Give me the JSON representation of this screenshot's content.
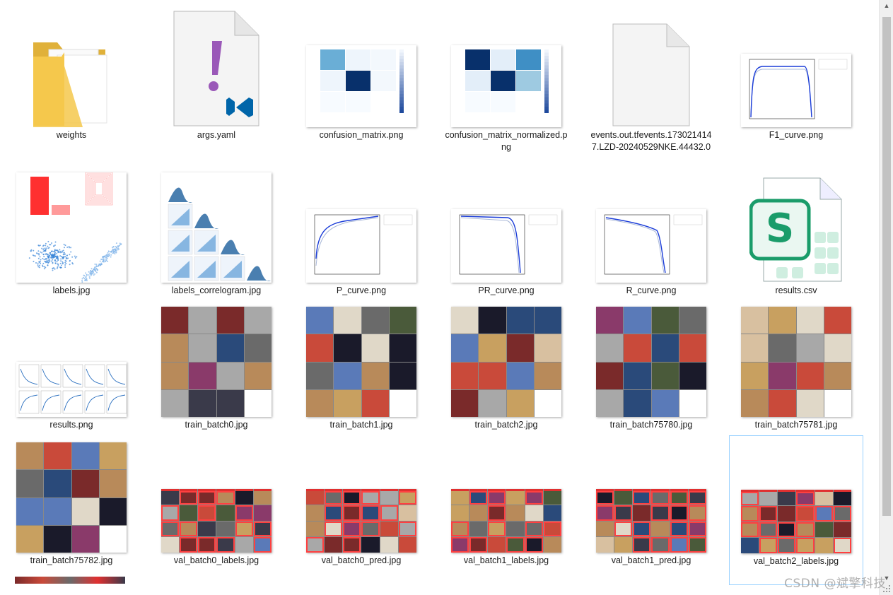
{
  "files": [
    {
      "name": "weights",
      "kind": "folder"
    },
    {
      "name": "args.yaml",
      "kind": "yaml"
    },
    {
      "name": "confusion_matrix.png",
      "kind": "cm"
    },
    {
      "name": "confusion_matrix_normalized.png",
      "kind": "cmn"
    },
    {
      "name": "events.out.tfevents.1730214147.LZD-20240529NKE.44432.0",
      "kind": "blank"
    },
    {
      "name": "F1_curve.png",
      "kind": "curve"
    },
    {
      "name": "labels.jpg",
      "kind": "labels"
    },
    {
      "name": "labels_correlogram.jpg",
      "kind": "correlogram"
    },
    {
      "name": "P_curve.png",
      "kind": "curve-p"
    },
    {
      "name": "PR_curve.png",
      "kind": "curve-pr"
    },
    {
      "name": "R_curve.png",
      "kind": "curve-r"
    },
    {
      "name": "results.csv",
      "kind": "sheet"
    },
    {
      "name": "results.png",
      "kind": "results"
    },
    {
      "name": "train_batch0.jpg",
      "kind": "mosaic"
    },
    {
      "name": "train_batch1.jpg",
      "kind": "mosaic"
    },
    {
      "name": "train_batch2.jpg",
      "kind": "mosaic"
    },
    {
      "name": "train_batch75780.jpg",
      "kind": "mosaic"
    },
    {
      "name": "train_batch75781.jpg",
      "kind": "mosaic"
    },
    {
      "name": "train_batch75782.jpg",
      "kind": "mosaic"
    },
    {
      "name": "val_batch0_labels.jpg",
      "kind": "val"
    },
    {
      "name": "val_batch0_pred.jpg",
      "kind": "val"
    },
    {
      "name": "val_batch1_labels.jpg",
      "kind": "val"
    },
    {
      "name": "val_batch1_pred.jpg",
      "kind": "val"
    },
    {
      "name": "val_batch2_labels.jpg",
      "kind": "val2",
      "selected": true
    }
  ],
  "icons": {
    "folder": "folder-icon",
    "yaml": "vscode-yaml-icon",
    "sheet": "spreadsheet-icon",
    "blank": "blank-file-icon"
  },
  "colors": {
    "folder": "#f5c84c",
    "vscode_blue": "#0065a9",
    "yaml_purple": "#9a58b8",
    "sheet_green": "#1a9c6a",
    "heat_dark": "#08306b",
    "heat_mid": "#4a90c8",
    "selection_border": "#99d1ff"
  },
  "watermark": "CSDN @斌擎科技"
}
